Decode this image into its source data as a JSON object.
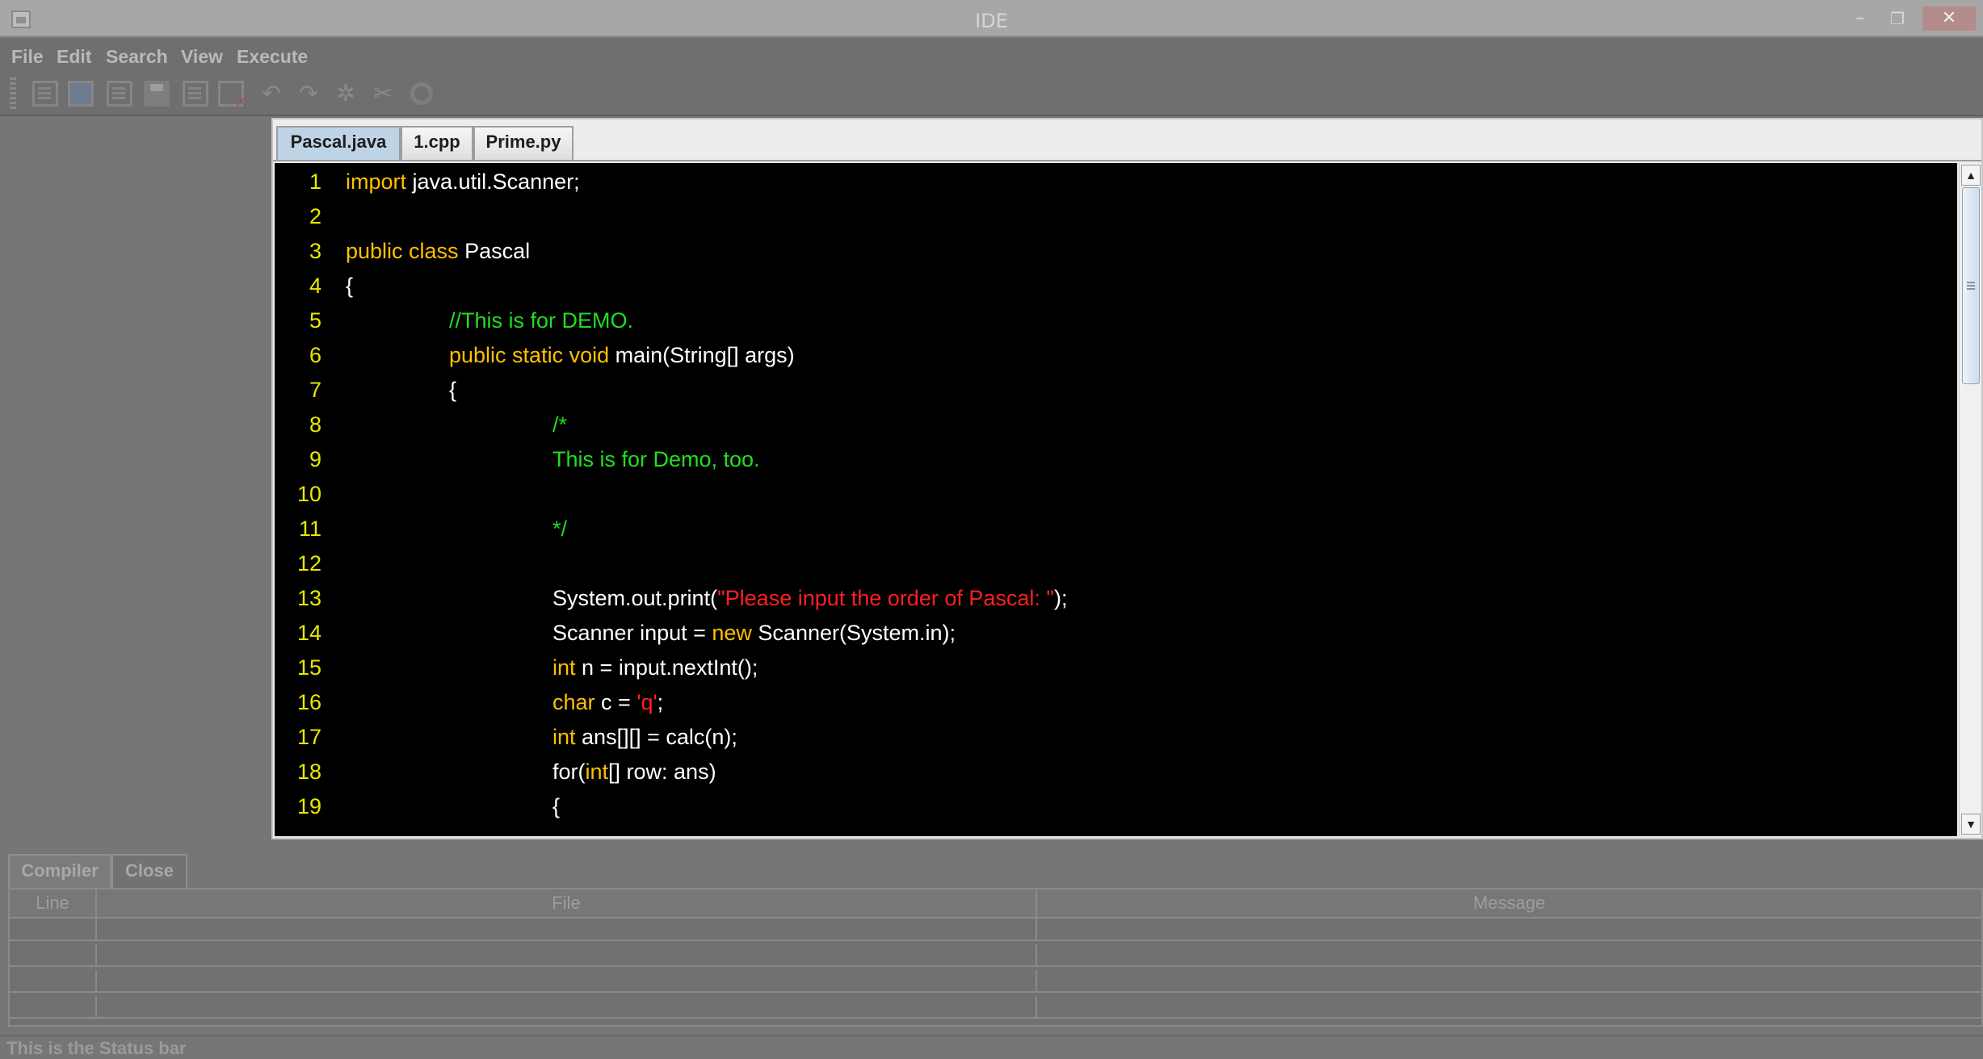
{
  "window": {
    "title": "IDE",
    "minimize": "–",
    "restore": "❐",
    "close": "✕"
  },
  "menu": {
    "file": "File",
    "edit": "Edit",
    "search": "Search",
    "view": "View",
    "execute": "Execute"
  },
  "editor": {
    "tabs": [
      "Pascal.java",
      "1.cpp",
      "Prime.py"
    ],
    "active_tab": "Pascal.java",
    "colors": {
      "keyword": "#ffc000",
      "comment": "#22dd22",
      "string": "#ff2020",
      "line_number": "#e8e800",
      "background": "#000000"
    },
    "lines": [
      {
        "n": "1",
        "indent": 0,
        "parts": [
          {
            "t": "import",
            "c": "kw"
          },
          {
            "t": " java.util.Scanner;",
            "c": ""
          }
        ]
      },
      {
        "n": "2",
        "indent": 0,
        "parts": []
      },
      {
        "n": "3",
        "indent": 0,
        "parts": [
          {
            "t": "public class",
            "c": "kw"
          },
          {
            "t": " Pascal",
            "c": ""
          }
        ]
      },
      {
        "n": "4",
        "indent": 0,
        "parts": [
          {
            "t": "{",
            "c": ""
          }
        ]
      },
      {
        "n": "5",
        "indent": 1,
        "parts": [
          {
            "t": "//This is for DEMO.",
            "c": "cm"
          }
        ]
      },
      {
        "n": "6",
        "indent": 1,
        "parts": [
          {
            "t": "public static void",
            "c": "kw"
          },
          {
            "t": " main(String[] args)",
            "c": ""
          }
        ]
      },
      {
        "n": "7",
        "indent": 1,
        "parts": [
          {
            "t": "{",
            "c": ""
          }
        ]
      },
      {
        "n": "8",
        "indent": 2,
        "parts": [
          {
            "t": "/*",
            "c": "cm"
          }
        ]
      },
      {
        "n": "9",
        "indent": 2,
        "parts": [
          {
            "t": "This is for Demo, too.",
            "c": "cm"
          }
        ]
      },
      {
        "n": "10",
        "indent": 2,
        "parts": []
      },
      {
        "n": "11",
        "indent": 2,
        "parts": [
          {
            "t": "*/",
            "c": "cm"
          }
        ]
      },
      {
        "n": "12",
        "indent": 2,
        "parts": []
      },
      {
        "n": "13",
        "indent": 2,
        "parts": [
          {
            "t": "System.out.print(",
            "c": ""
          },
          {
            "t": "\"Please input the order of Pascal: \"",
            "c": "st"
          },
          {
            "t": ");",
            "c": ""
          }
        ]
      },
      {
        "n": "14",
        "indent": 2,
        "parts": [
          {
            "t": "Scanner input = ",
            "c": ""
          },
          {
            "t": "new",
            "c": "kw"
          },
          {
            "t": " Scanner(System.in);",
            "c": ""
          }
        ]
      },
      {
        "n": "15",
        "indent": 2,
        "parts": [
          {
            "t": "int",
            "c": "kw"
          },
          {
            "t": " n = input.nextInt();",
            "c": ""
          }
        ]
      },
      {
        "n": "16",
        "indent": 2,
        "parts": [
          {
            "t": "char",
            "c": "kw"
          },
          {
            "t": " c = ",
            "c": ""
          },
          {
            "t": "'q'",
            "c": "st"
          },
          {
            "t": ";",
            "c": ""
          }
        ]
      },
      {
        "n": "17",
        "indent": 2,
        "parts": [
          {
            "t": "int",
            "c": "kw"
          },
          {
            "t": " ans[][] = calc(n);",
            "c": ""
          }
        ]
      },
      {
        "n": "18",
        "indent": 2,
        "parts": [
          {
            "t": "for(",
            "c": ""
          },
          {
            "t": "int",
            "c": "kw"
          },
          {
            "t": "[] row: ans)",
            "c": ""
          }
        ]
      },
      {
        "n": "19",
        "indent": 2,
        "parts": [
          {
            "t": "{",
            "c": ""
          }
        ]
      }
    ]
  },
  "compiler_panel": {
    "tabs": [
      "Compiler",
      "Close"
    ],
    "columns": [
      "Line",
      "File",
      "Message"
    ]
  },
  "status": {
    "text": "This is the Status bar"
  }
}
